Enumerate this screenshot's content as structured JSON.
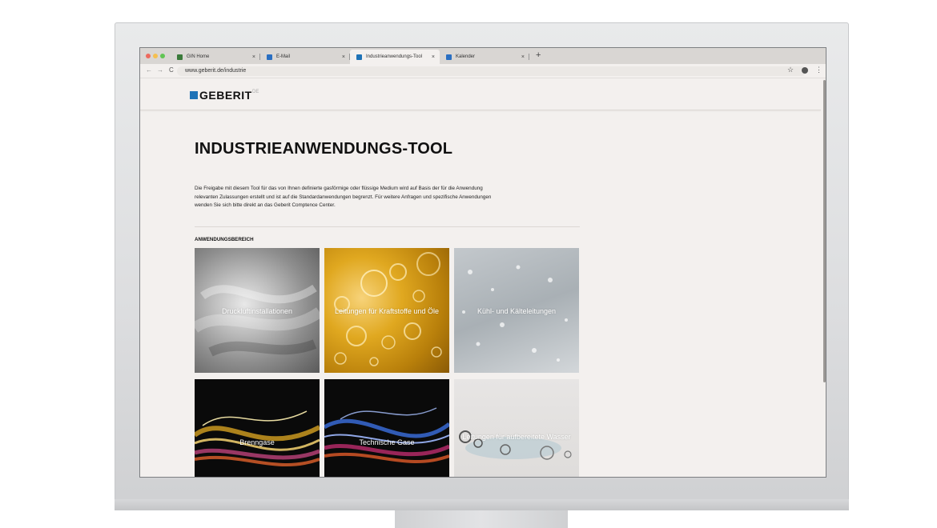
{
  "browser": {
    "tabs": [
      {
        "label": "GIN Home",
        "favicon_color": "#3a7a3a",
        "active": false
      },
      {
        "label": "E-Mail",
        "favicon_color": "#2a6fc2",
        "active": false
      },
      {
        "label": "Industrieanwendungs-Tool",
        "favicon_color": "#1f73b7",
        "active": true
      },
      {
        "label": "Kalender",
        "favicon_color": "#2a6fc2",
        "active": false
      }
    ],
    "close_glyph": "×",
    "new_tab_glyph": "+",
    "back_glyph": "←",
    "forward_glyph": "→",
    "reload_glyph": "C",
    "url": "www.geberit.de/industrie",
    "bookmark_glyph": "☆",
    "menu_glyph": "⋮",
    "traffic_colors": [
      "#ed6a5e",
      "#f5bf4f",
      "#61c554"
    ]
  },
  "site": {
    "logo_text": "GEBERIT",
    "logo_suffix": "DE",
    "brand_color": "#1f73b7"
  },
  "main": {
    "title": "INDUSTRIEANWENDUNGS-TOOL",
    "intro": "Die Freigabe mit diesem Tool für das von Ihnen definierte gasförmige oder flüssige Medium wird auf Basis der für die Anwendung relevanten Zulassungen erstellt und ist auf die Standardanwendungen begrenzt. Für weitere Anfragen und spezifische Anwendungen wenden Sie sich bitte direkt an das Geberit Comptence Center.",
    "section_label": "ANWENDUNGSBEREICH",
    "tiles": [
      {
        "label": "Druckluftinstallationen"
      },
      {
        "label": "Leitungen für Kraftstoffe und Öle"
      },
      {
        "label": "Kühl- und Kälteleitungen"
      },
      {
        "label": "Brenngase"
      },
      {
        "label": "Technische Gase"
      },
      {
        "label": "Leitungen für aufbereitete Wasser"
      }
    ]
  }
}
